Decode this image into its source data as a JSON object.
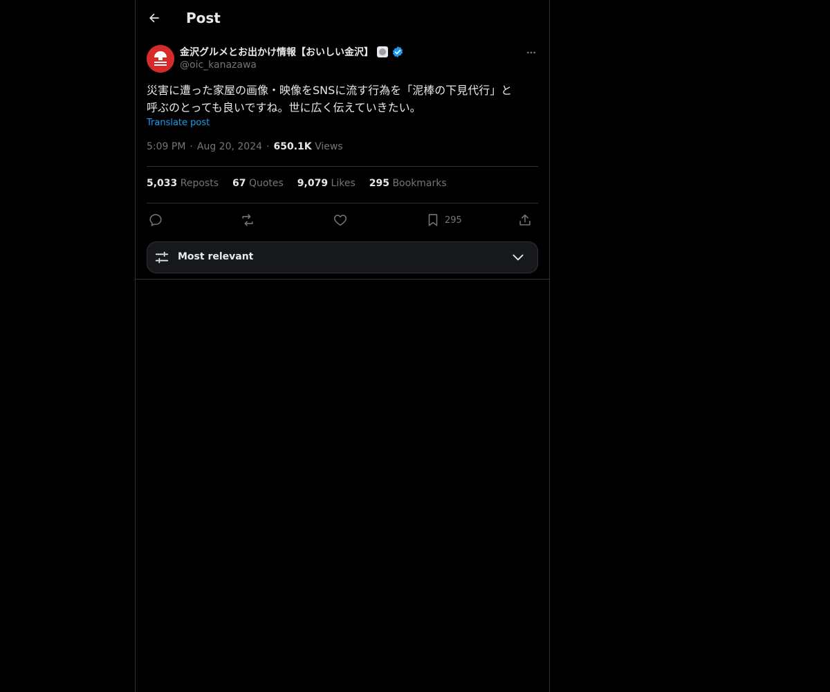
{
  "header": {
    "title": "Post"
  },
  "author": {
    "display_name": "金沢グルメとお出かけ情報【おいしい金沢】",
    "handle": "@oic_kanazawa",
    "avatar_color": "#d72b2b",
    "verified_color": "#1d9bf0"
  },
  "post": {
    "text": "災害に遭った家屋の画像・映像をSNSに流す行為を「泥棒の下見代行」と\n呼ぶのとっても良いですね。世に広く伝えていきたい。",
    "translate_label": "Translate post",
    "time": "5:09 PM",
    "date": "Aug 20, 2024",
    "views_count": "650.1K",
    "views_label": "Views"
  },
  "stats": {
    "reposts_count": "5,033",
    "reposts_label": "Reposts",
    "quotes_count": "67",
    "quotes_label": "Quotes",
    "likes_count": "9,079",
    "likes_label": "Likes",
    "bookmarks_count": "295",
    "bookmarks_label": "Bookmarks"
  },
  "actions": {
    "bookmark_count": "295"
  },
  "sort": {
    "label": "Most relevant"
  },
  "colors": {
    "accent": "#1d9bf0",
    "muted": "#71767b",
    "border": "#2f3336"
  }
}
